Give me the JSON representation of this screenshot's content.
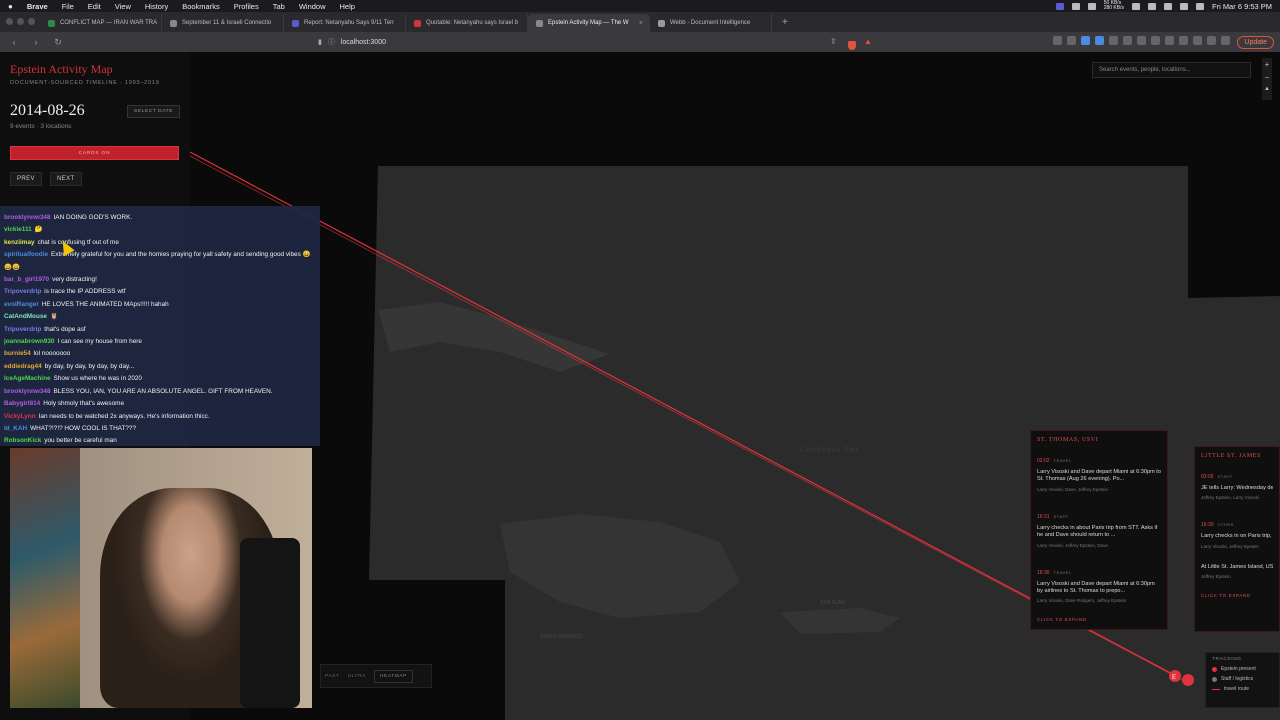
{
  "menubar": {
    "app": "Brave",
    "items": [
      "File",
      "Edit",
      "View",
      "History",
      "Bookmarks",
      "Profiles",
      "Tab",
      "Window",
      "Help"
    ],
    "net_up": "50 KB/s",
    "net_down": "280 KB/s",
    "clock": "Fri Mar 6  9:53 PM"
  },
  "tabs": [
    {
      "title": "CONFLICT MAP — IRAN WAR TRA",
      "fav": "#2c8a4a"
    },
    {
      "title": "September 11 & Israeli Connectio",
      "fav": "#888888"
    },
    {
      "title": "Report: Netanyahu Says 9/11 Terr",
      "fav": "#5b5bd6"
    },
    {
      "title": "Quotable: Netanyahu says Israel b",
      "fav": "#d0343e"
    },
    {
      "title": "Epstein Activity Map — The W",
      "fav": "#888888",
      "active": true
    },
    {
      "title": "Webb - Document Intelligence",
      "fav": "#999999"
    }
  ],
  "toolbar": {
    "url": "localhost:3000",
    "update_label": "Update"
  },
  "sidebar": {
    "title": "Epstein Activity Map",
    "subtitle": "DOCUMENT-SOURCED TIMELINE · 1993–2019",
    "date": "2014-08-26",
    "select_date": "SELECT DATE",
    "stats": "9 events · 3 locations",
    "cards_toggle": "CARDS ON",
    "prev": "PREV",
    "next": "NEXT"
  },
  "search": {
    "placeholder": "Search events, people, locations..."
  },
  "zoom": {
    "plus": "+",
    "minus": "−",
    "compass": "▲"
  },
  "chat": {
    "messages": [
      {
        "user": "brooklynnw348",
        "color": "#b05ce0",
        "text": "IAN DOING GOD'S WORK."
      },
      {
        "user": "vickie111",
        "color": "#49d94a",
        "text": "🤔"
      },
      {
        "user": "kenziimay",
        "color": "#e3e34a",
        "text": "chat is confusing tf out of me"
      },
      {
        "user": "spiritualfoodie",
        "color": "#4a8ce0",
        "text": "Extremely grateful for you and the homies praying for yall safety and sending good vibes 😄😄😄"
      },
      {
        "user": "bar_b_girl1970",
        "color": "#b05ce0",
        "text": "very distracting!"
      },
      {
        "user": "Tripoverdrip",
        "color": "#7a7ae8",
        "text": "is trace the IP ADDRESS wtf"
      },
      {
        "user": "evolRanger",
        "color": "#4a8ce0",
        "text": "HE LOVES THE ANIMATED MAps!!!!! hahah"
      },
      {
        "user": "CatAndMouse",
        "color": "#7fe6c0",
        "text": "🦉"
      },
      {
        "user": "Tripoverdrip",
        "color": "#7a7ae8",
        "text": "that's dope asf"
      },
      {
        "user": "joannabrown930",
        "color": "#49d94a",
        "text": "I can see my house from here"
      },
      {
        "user": "burnie54",
        "color": "#e8a33a",
        "text": "lol nooooooo"
      },
      {
        "user": "eddiedrag44",
        "color": "#e8a33a",
        "text": "by day, by day, by day, by day..."
      },
      {
        "user": "IceAgeMachine",
        "color": "#49d94a",
        "text": "Show us where he was in 2020"
      },
      {
        "user": "brooklynnw348",
        "color": "#b05ce0",
        "text": "BLESS YOU, IAN, YOU ARE AN ABSOLUTE ANGEL. GIFT FROM HEAVEN."
      },
      {
        "user": "Babygirl814",
        "color": "#b05ce0",
        "text": "Holy shmoly that's awesome"
      },
      {
        "user": "VickyLynn",
        "color": "#e0334d",
        "text": "Ian needs to be watched 2x anyways. He's information thicc."
      },
      {
        "user": "Id_KAH",
        "color": "#4a8ce0",
        "text": "WHAT?!?!? HOW COOL IS THAT???"
      },
      {
        "user": "RobsonKick",
        "color": "#49d94a",
        "text": "you better be careful man"
      }
    ]
  },
  "cards": [
    {
      "location": "ST. THOMAS, USVI",
      "footer": "CLICK TO EXPAND",
      "events": [
        {
          "time": "02:02",
          "tag": "TRAVEL",
          "text": "Larry Visoski and Dave depart Miami at 6:30pm to St. Thomas (Aug 26 evening). Po...",
          "people": "Larry Visoski, Dave, Jeffrey Epstein"
        },
        {
          "time": "16:31",
          "tag": "STAFF",
          "text": "Larry checks in about Paris trip from STT. Asks if he and Dave should return to ...",
          "people": "Larry Visoski, Jeffrey Epstein, Dave"
        },
        {
          "time": "18:30",
          "tag": "TRAVEL",
          "text": "Larry Visoski and Dave depart Miami at 6:30pm by airlines to St. Thomas to prepo...",
          "people": "Larry Visoski, Dave Rodgers, Jeffrey Epstein"
        }
      ]
    },
    {
      "location": "LITTLE ST. JAMES",
      "footer": "CLICK TO EXPAND",
      "events": [
        {
          "time": "03:05",
          "tag": "STAFF",
          "text": "JE tells Larry: Wednesday departure likely delayed until Thursday...",
          "people": "Jeffrey Epstein, Larry Visoski"
        },
        {
          "time": "16:30",
          "tag": "OTHER",
          "text": "Larry checks in on Paris trip, asks if Dave and Larry should...",
          "people": "Larry Visoski, Jeffrey Epstein"
        },
        {
          "time": "",
          "tag": "",
          "text": "At Little St. James Island, USVI, Cyril E. King Airport, St. Thomas...",
          "people": "Jeffrey Epstein"
        }
      ]
    }
  ],
  "modes": {
    "items": [
      "PAST",
      "ULTRA"
    ],
    "heatmap": "HEATMAP"
  },
  "legend": {
    "title": "TRACKING",
    "items": [
      {
        "label": "Epstein present",
        "color": "#e0333d"
      },
      {
        "label": "Staff / logistics",
        "color": "#777777"
      }
    ],
    "route_label": "travel route"
  },
  "marker_label": "E",
  "map_labels": [
    {
      "text": "Caribbean Sea"
    },
    {
      "text": "SAN JUAN"
    },
    {
      "text": "SANTO DOMINGO"
    }
  ]
}
